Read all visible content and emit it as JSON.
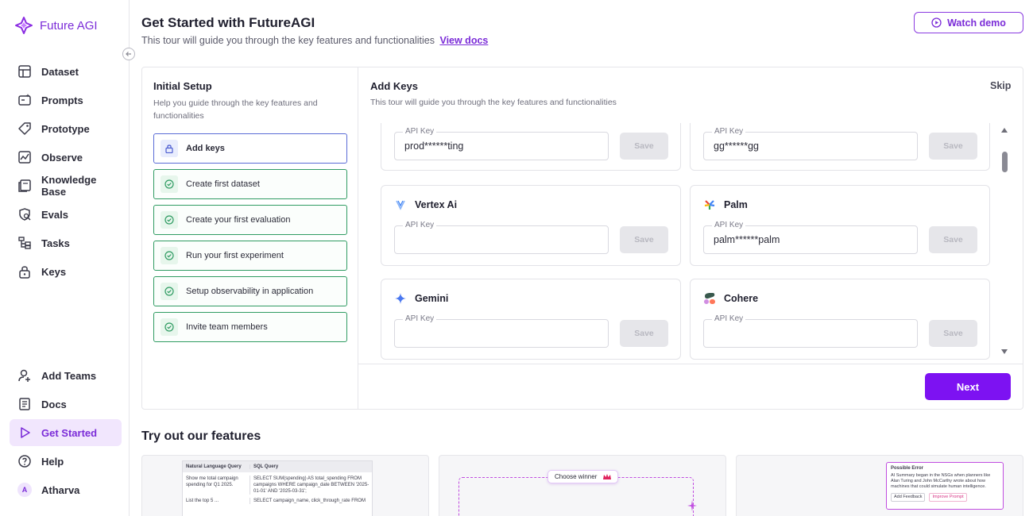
{
  "brand": {
    "name": "Future AGI"
  },
  "sidebar": {
    "items": [
      {
        "label": "Dataset",
        "icon": "table-icon"
      },
      {
        "label": "Prompts",
        "icon": "prompts-icon"
      },
      {
        "label": "Prototype",
        "icon": "tag-icon"
      },
      {
        "label": "Observe",
        "icon": "chart-icon"
      },
      {
        "label": "Knowledge Base",
        "icon": "book-icon"
      },
      {
        "label": "Evals",
        "icon": "evals-icon"
      },
      {
        "label": "Tasks",
        "icon": "tasks-icon"
      },
      {
        "label": "Keys",
        "icon": "lock-icon"
      }
    ],
    "bottom_items": [
      {
        "label": "Add Teams",
        "icon": "add-user-icon"
      },
      {
        "label": "Docs",
        "icon": "document-icon"
      },
      {
        "label": "Get Started",
        "icon": "play-icon",
        "active": true
      },
      {
        "label": "Help",
        "icon": "help-icon"
      }
    ],
    "user": {
      "initial": "A",
      "name": "Atharva"
    }
  },
  "header": {
    "title": "Get Started with FutureAGI",
    "subtitle": "This tour will guide you through the key features and functionalities",
    "docs_link": "View docs",
    "watch_demo": "Watch demo"
  },
  "setup": {
    "title": "Initial Setup",
    "subtitle": "Help you guide through the key features and functionalities",
    "steps": [
      {
        "label": "Add keys",
        "state": "active",
        "icon": "lock-icon"
      },
      {
        "label": "Create first dataset",
        "state": "done",
        "icon": "check-circle-icon"
      },
      {
        "label": "Create your first evaluation",
        "state": "done",
        "icon": "check-circle-icon"
      },
      {
        "label": "Run your first experiment",
        "state": "done",
        "icon": "check-circle-icon"
      },
      {
        "label": "Setup observability in application",
        "state": "done",
        "icon": "check-circle-icon"
      },
      {
        "label": "Invite team members",
        "state": "done",
        "icon": "check-circle-icon"
      }
    ]
  },
  "keys": {
    "title": "Add Keys",
    "subtitle": "This tour will guide you through the key features and functionalities",
    "skip": "Skip",
    "field_label": "API Key",
    "save_label": "Save",
    "next_label": "Next",
    "providers": [
      {
        "name": "",
        "value": "prod******ting"
      },
      {
        "name": "",
        "value": "gg******gg"
      },
      {
        "name": "Vertex Ai",
        "value": "",
        "icon": "vertex-ai-logo-icon"
      },
      {
        "name": "Palm",
        "value": "palm******palm",
        "icon": "palm-logo-icon"
      },
      {
        "name": "Gemini",
        "value": "",
        "icon": "gemini-logo-icon"
      },
      {
        "name": "Cohere",
        "value": "",
        "icon": "cohere-logo-icon"
      }
    ]
  },
  "features": {
    "title": "Try out our features",
    "sql_preview": {
      "headers": [
        "Natural Language Query",
        "SQL Query"
      ],
      "rows": [
        [
          "Show me total campaign spending for Q1 2025.",
          "SELECT SUM(spending) AS total_spending FROM campaigns WHERE campaign_date BETWEEN '2025-01-01' AND '2025-03-31';"
        ],
        [
          "List the top 5 ...",
          "SELECT campaign_name, click_through_rate FROM"
        ]
      ]
    },
    "winner_preview": {
      "label": "Choose winner"
    },
    "error_preview": {
      "title": "Possible Error",
      "text": "AI Summary began in the NSGs when planners like Alan Turing and John McCarthy wrote about how machines that could simulate human intelligence.",
      "actions": [
        "Add Feedback",
        "Improve Prompt"
      ]
    }
  }
}
